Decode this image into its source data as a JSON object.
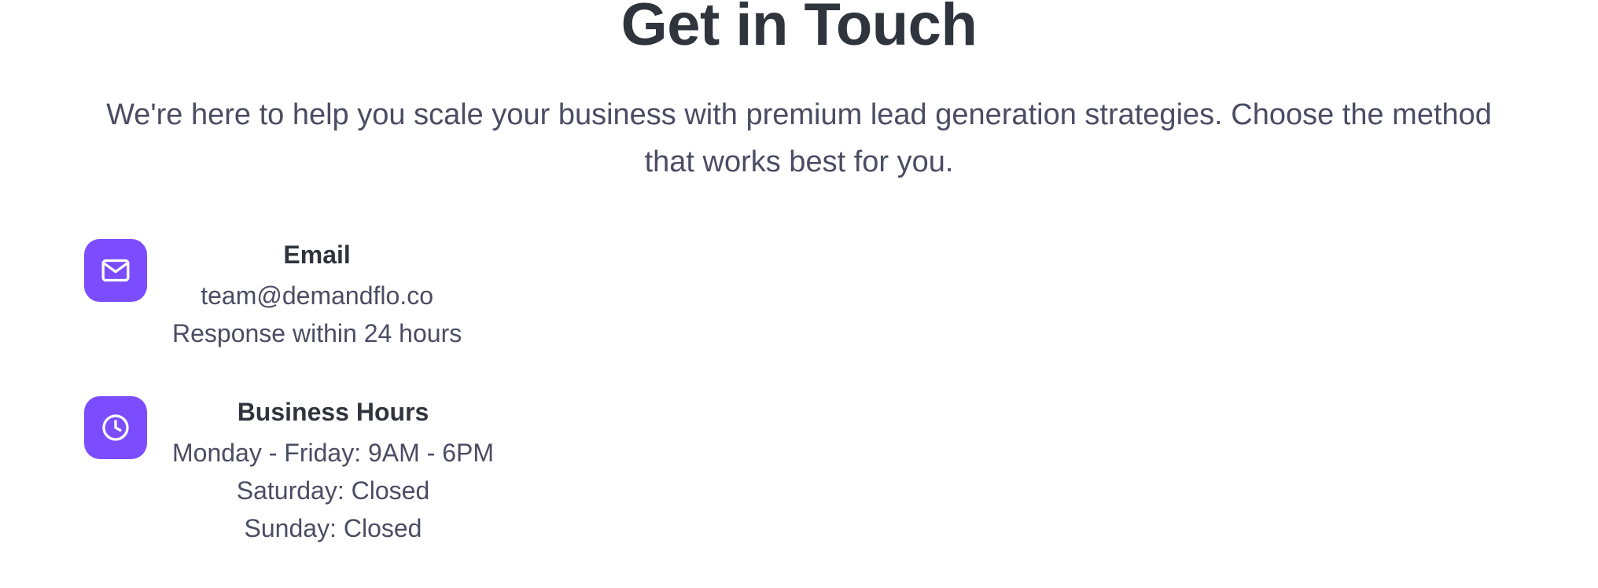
{
  "header": {
    "title": "Get in Touch",
    "subtitle": "We're here to help you scale your business with premium lead generation strategies. Choose the method that works best for you."
  },
  "contact_methods": [
    {
      "icon": "mail-icon",
      "heading": "Email",
      "lines": [
        "team@demandflo.co",
        "Response within 24 hours"
      ]
    },
    {
      "icon": "clock-icon",
      "heading": "Business Hours",
      "lines": [
        "Monday - Friday: 9AM - 6PM",
        "Saturday: Closed",
        "Sunday: Closed"
      ]
    }
  ],
  "colors": {
    "accent": "#7c4dff",
    "heading_text": "#2f343d",
    "body_text": "#4a4d63",
    "background": "#ffffff"
  }
}
